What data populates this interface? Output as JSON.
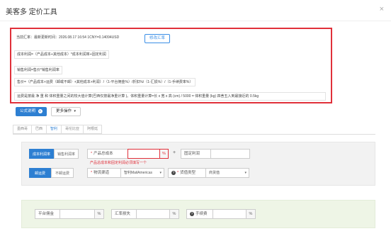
{
  "header": {
    "title": "美客多 定价工具",
    "close_glyph": "×"
  },
  "info": {
    "rate_line": "当前汇率：最新更新时间：2026.08.17 16:54 1CNY=0.14094USD",
    "rate_button": "修改汇率",
    "formula_cost": "成本利润=（产品成本+其他成本）*成本利润率+固定利润",
    "formula_sale": "销售利润=售价*销售利润率",
    "formula_price": "售价=（产品成本+运费（邮或不邮）+其他成本+利润）/（1-平台佣金%）/折扣%/（1-汇损%）/（1-手续费率%）",
    "formula_weight": "运费是按最 净 重 和 体积重量之间的较大值计算(巴西仅按最净重计算 )。体积重量计算=长 x 宽 x 高 (cm) / 5000 = 体积重量 (kg) 四舍五入到最接近的 0.5kg"
  },
  "toolbar": {
    "formula_btn": "公式说明",
    "more_btn": "更多操作"
  },
  "tabs": [
    "墨西哥",
    "巴西",
    "智利",
    "哥伦比亚",
    "阿根廷"
  ],
  "active_tab": 2,
  "form": {
    "profit_mode": [
      "成本利润率",
      "销售利润率"
    ],
    "product_cost_label": "产品总成本",
    "percent": "%",
    "plus": "+",
    "fixed_profit_label": "固定利润",
    "error_msg": "产品总成本和固定利润必须填写一个",
    "shipping_mode": [
      "邮运费",
      "不邮运费"
    ],
    "logistics_label": "物流渠道",
    "logistics_value": "智利MailAmericas",
    "goods_type_label": "货值类型",
    "goods_type_value": "商货值",
    "platform_fee_label": "平台佣金",
    "fx_loss_label": "汇率损失",
    "handling_fee_label": "手续费"
  },
  "colors": {
    "primary": "#2d7fd2",
    "highlight_border": "#e0303a",
    "panel_bg": "#f2f2f2",
    "panel2_bg": "#eef5e6"
  }
}
